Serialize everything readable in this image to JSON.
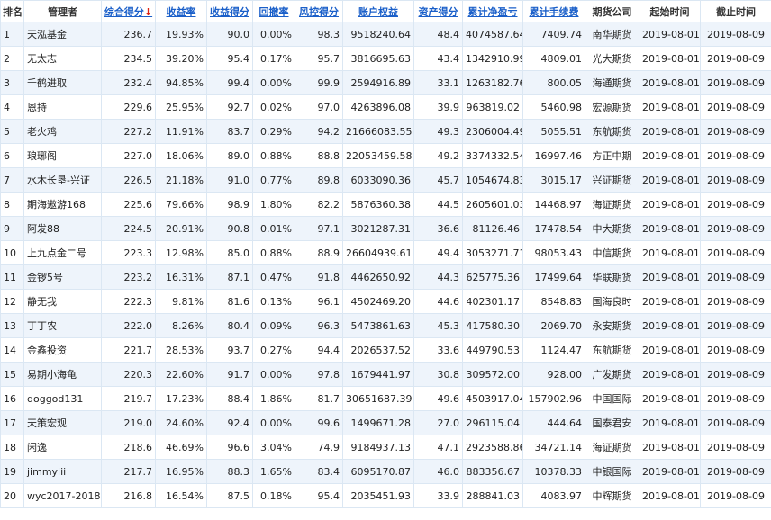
{
  "headers": {
    "rank": "排名",
    "manager": "管理者",
    "score": "综合得分",
    "score_sort": "↓",
    "return_rate": "收益率",
    "return_score": "收益得分",
    "drawdown": "回撤率",
    "risk_score": "风控得分",
    "equity": "账户权益",
    "asset_score": "资产得分",
    "net_pnl": "累计净盈亏",
    "fees": "累计手续费",
    "company": "期货公司",
    "start": "起始时间",
    "end": "截止时间"
  },
  "rows": [
    {
      "rank": "1",
      "manager": "天泓基金",
      "score": "236.7",
      "return_rate": "19.93%",
      "return_score": "90.0",
      "drawdown": "0.00%",
      "risk_score": "98.3",
      "equity": "9518240.64",
      "asset_score": "48.4",
      "net_pnl": "4074587.64",
      "fees": "7409.74",
      "company": "南华期货",
      "start": "2019-08-01",
      "end": "2019-08-09"
    },
    {
      "rank": "2",
      "manager": "无太志",
      "score": "234.5",
      "return_rate": "39.20%",
      "return_score": "95.4",
      "drawdown": "0.17%",
      "risk_score": "95.7",
      "equity": "3816695.63",
      "asset_score": "43.4",
      "net_pnl": "1342910.99",
      "fees": "4809.01",
      "company": "光大期货",
      "start": "2019-08-01",
      "end": "2019-08-09"
    },
    {
      "rank": "3",
      "manager": "千鹤进取",
      "score": "232.4",
      "return_rate": "94.85%",
      "return_score": "99.4",
      "drawdown": "0.00%",
      "risk_score": "99.9",
      "equity": "2594916.89",
      "asset_score": "33.1",
      "net_pnl": "1263182.76",
      "fees": "800.05",
      "company": "海通期货",
      "start": "2019-08-01",
      "end": "2019-08-09"
    },
    {
      "rank": "4",
      "manager": "恩持",
      "score": "229.6",
      "return_rate": "25.95%",
      "return_score": "92.7",
      "drawdown": "0.02%",
      "risk_score": "97.0",
      "equity": "4263896.08",
      "asset_score": "39.9",
      "net_pnl": "963819.02",
      "fees": "5460.98",
      "company": "宏源期货",
      "start": "2019-08-01",
      "end": "2019-08-09"
    },
    {
      "rank": "5",
      "manager": "老火鸡",
      "score": "227.2",
      "return_rate": "11.91%",
      "return_score": "83.7",
      "drawdown": "0.29%",
      "risk_score": "94.2",
      "equity": "21666083.55",
      "asset_score": "49.3",
      "net_pnl": "2306004.49",
      "fees": "5055.51",
      "company": "东航期货",
      "start": "2019-08-01",
      "end": "2019-08-09"
    },
    {
      "rank": "6",
      "manager": "琅琊阁",
      "score": "227.0",
      "return_rate": "18.06%",
      "return_score": "89.0",
      "drawdown": "0.88%",
      "risk_score": "88.8",
      "equity": "22053459.58",
      "asset_score": "49.2",
      "net_pnl": "3374332.54",
      "fees": "16997.46",
      "company": "方正中期",
      "start": "2019-08-01",
      "end": "2019-08-09"
    },
    {
      "rank": "7",
      "manager": "水木长垦-兴证",
      "score": "226.5",
      "return_rate": "21.18%",
      "return_score": "91.0",
      "drawdown": "0.77%",
      "risk_score": "89.8",
      "equity": "6033090.36",
      "asset_score": "45.7",
      "net_pnl": "1054674.83",
      "fees": "3015.17",
      "company": "兴证期货",
      "start": "2019-08-01",
      "end": "2019-08-09"
    },
    {
      "rank": "8",
      "manager": "期海遨游168",
      "score": "225.6",
      "return_rate": "79.66%",
      "return_score": "98.9",
      "drawdown": "1.80%",
      "risk_score": "82.2",
      "equity": "5876360.38",
      "asset_score": "44.5",
      "net_pnl": "2605601.03",
      "fees": "14468.97",
      "company": "海证期货",
      "start": "2019-08-01",
      "end": "2019-08-09"
    },
    {
      "rank": "9",
      "manager": "阿发88",
      "score": "224.5",
      "return_rate": "20.91%",
      "return_score": "90.8",
      "drawdown": "0.01%",
      "risk_score": "97.1",
      "equity": "3021287.31",
      "asset_score": "36.6",
      "net_pnl": "81126.46",
      "fees": "17478.54",
      "company": "中大期货",
      "start": "2019-08-01",
      "end": "2019-08-09"
    },
    {
      "rank": "10",
      "manager": "上九点金二号",
      "score": "223.3",
      "return_rate": "12.98%",
      "return_score": "85.0",
      "drawdown": "0.88%",
      "risk_score": "88.9",
      "equity": "26604939.61",
      "asset_score": "49.4",
      "net_pnl": "3053271.71",
      "fees": "98053.43",
      "company": "中信期货",
      "start": "2019-08-01",
      "end": "2019-08-09"
    },
    {
      "rank": "11",
      "manager": "金锣5号",
      "score": "223.2",
      "return_rate": "16.31%",
      "return_score": "87.1",
      "drawdown": "0.47%",
      "risk_score": "91.8",
      "equity": "4462650.92",
      "asset_score": "44.3",
      "net_pnl": "625775.36",
      "fees": "17499.64",
      "company": "华联期货",
      "start": "2019-08-01",
      "end": "2019-08-09"
    },
    {
      "rank": "12",
      "manager": "静无我",
      "score": "222.3",
      "return_rate": "9.81%",
      "return_score": "81.6",
      "drawdown": "0.13%",
      "risk_score": "96.1",
      "equity": "4502469.20",
      "asset_score": "44.6",
      "net_pnl": "402301.17",
      "fees": "8548.83",
      "company": "国海良时",
      "start": "2019-08-01",
      "end": "2019-08-09"
    },
    {
      "rank": "13",
      "manager": "丁丁农",
      "score": "222.0",
      "return_rate": "8.26%",
      "return_score": "80.4",
      "drawdown": "0.09%",
      "risk_score": "96.3",
      "equity": "5473861.63",
      "asset_score": "45.3",
      "net_pnl": "417580.30",
      "fees": "2069.70",
      "company": "永安期货",
      "start": "2019-08-01",
      "end": "2019-08-09"
    },
    {
      "rank": "14",
      "manager": "金鑫投资",
      "score": "221.7",
      "return_rate": "28.53%",
      "return_score": "93.7",
      "drawdown": "0.27%",
      "risk_score": "94.4",
      "equity": "2026537.52",
      "asset_score": "33.6",
      "net_pnl": "449790.53",
      "fees": "1124.47",
      "company": "东航期货",
      "start": "2019-08-01",
      "end": "2019-08-09"
    },
    {
      "rank": "15",
      "manager": "易期小海龟",
      "score": "220.3",
      "return_rate": "22.60%",
      "return_score": "91.7",
      "drawdown": "0.00%",
      "risk_score": "97.8",
      "equity": "1679441.97",
      "asset_score": "30.8",
      "net_pnl": "309572.00",
      "fees": "928.00",
      "company": "广发期货",
      "start": "2019-08-01",
      "end": "2019-08-09"
    },
    {
      "rank": "16",
      "manager": "doggod131",
      "score": "219.7",
      "return_rate": "17.23%",
      "return_score": "88.4",
      "drawdown": "1.86%",
      "risk_score": "81.7",
      "equity": "30651687.39",
      "asset_score": "49.6",
      "net_pnl": "4503917.04",
      "fees": "157902.96",
      "company": "中国国际",
      "start": "2019-08-01",
      "end": "2019-08-09"
    },
    {
      "rank": "17",
      "manager": "天策宏观",
      "score": "219.0",
      "return_rate": "24.60%",
      "return_score": "92.4",
      "drawdown": "0.00%",
      "risk_score": "99.6",
      "equity": "1499671.28",
      "asset_score": "27.0",
      "net_pnl": "296115.04",
      "fees": "444.64",
      "company": "国泰君安",
      "start": "2019-08-01",
      "end": "2019-08-09"
    },
    {
      "rank": "18",
      "manager": "闲逸",
      "score": "218.6",
      "return_rate": "46.69%",
      "return_score": "96.6",
      "drawdown": "3.04%",
      "risk_score": "74.9",
      "equity": "9184937.13",
      "asset_score": "47.1",
      "net_pnl": "2923588.86",
      "fees": "34721.14",
      "company": "海证期货",
      "start": "2019-08-01",
      "end": "2019-08-09"
    },
    {
      "rank": "19",
      "manager": "jimmyiii",
      "score": "217.7",
      "return_rate": "16.95%",
      "return_score": "88.3",
      "drawdown": "1.65%",
      "risk_score": "83.4",
      "equity": "6095170.87",
      "asset_score": "46.0",
      "net_pnl": "883356.67",
      "fees": "10378.33",
      "company": "中银国际",
      "start": "2019-08-01",
      "end": "2019-08-09"
    },
    {
      "rank": "20",
      "manager": "wyc2017-2018",
      "score": "216.8",
      "return_rate": "16.54%",
      "return_score": "87.5",
      "drawdown": "0.18%",
      "risk_score": "95.4",
      "equity": "2035451.93",
      "asset_score": "33.9",
      "net_pnl": "288841.03",
      "fees": "4083.97",
      "company": "中辉期货",
      "start": "2019-08-01",
      "end": "2019-08-09"
    }
  ],
  "colors": {
    "link": "#1a5fc9",
    "pnl": "#e2002a",
    "row_alt": "#eef4fb",
    "border": "#dbe7f3"
  }
}
